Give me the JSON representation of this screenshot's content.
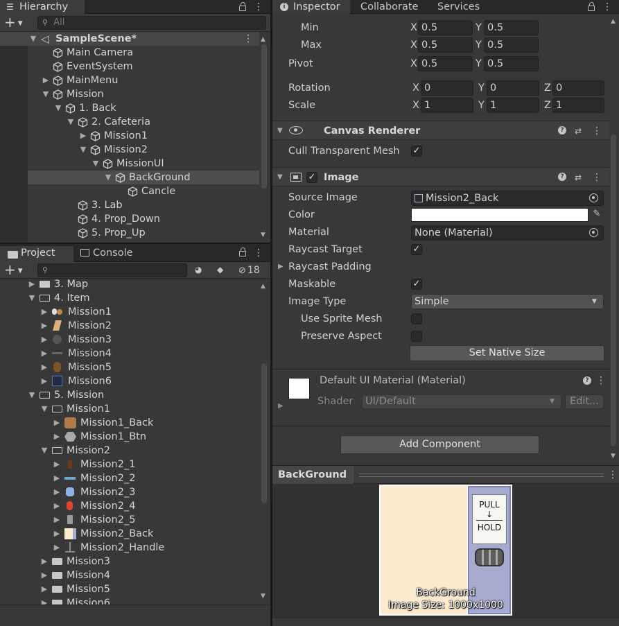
{
  "hierarchy": {
    "tab": "Hierarchy",
    "search_placeholder": "All",
    "scene": "SampleScene*",
    "items": [
      {
        "label": "Main Camera"
      },
      {
        "label": "EventSystem"
      },
      {
        "label": "MainMenu"
      },
      {
        "label": "Mission"
      },
      {
        "label": "1. Back"
      },
      {
        "label": "2. Cafeteria"
      },
      {
        "label": "Mission1"
      },
      {
        "label": "Mission2"
      },
      {
        "label": "MissionUI"
      },
      {
        "label": "BackGround"
      },
      {
        "label": "Cancle"
      },
      {
        "label": "3. Lab"
      },
      {
        "label": "4. Prop_Down"
      },
      {
        "label": "5. Prop_Up"
      }
    ]
  },
  "project": {
    "tabs": [
      "Project",
      "Console"
    ],
    "hidden_count": "18",
    "items": [
      {
        "label": "3. Map"
      },
      {
        "label": "4. Item"
      },
      {
        "label": "Mission1"
      },
      {
        "label": "Mission2"
      },
      {
        "label": "Mission3"
      },
      {
        "label": "Mission4"
      },
      {
        "label": "Mission5"
      },
      {
        "label": "Mission6"
      },
      {
        "label": "5. Mission"
      },
      {
        "label": "Mission1"
      },
      {
        "label": "Mission1_Back"
      },
      {
        "label": "Mission1_Btn"
      },
      {
        "label": "Mission2"
      },
      {
        "label": "Mission2_1"
      },
      {
        "label": "Mission2_2"
      },
      {
        "label": "Mission2_3"
      },
      {
        "label": "Mission2_4"
      },
      {
        "label": "Mission2_5"
      },
      {
        "label": "Mission2_Back"
      },
      {
        "label": "Mission2_Handle"
      },
      {
        "label": "Mission3"
      },
      {
        "label": "Mission4"
      },
      {
        "label": "Mission5"
      },
      {
        "label": "Mission6"
      }
    ]
  },
  "inspector": {
    "tabs": [
      "Inspector",
      "Collaborate",
      "Services"
    ],
    "anchors": {
      "min_label": "Min",
      "min_x": "0.5",
      "min_y": "0.5",
      "max_label": "Max",
      "max_x": "0.5",
      "max_y": "0.5"
    },
    "pivot": {
      "label": "Pivot",
      "x": "0.5",
      "y": "0.5"
    },
    "rotation": {
      "label": "Rotation",
      "x": "0",
      "y": "0",
      "z": "0"
    },
    "scale": {
      "label": "Scale",
      "x": "1",
      "y": "1",
      "z": "1"
    },
    "axes": {
      "x": "X",
      "y": "Y",
      "z": "Z"
    },
    "canvas_renderer": {
      "title": "Canvas Renderer",
      "cull_label": "Cull Transparent Mesh",
      "cull_checked": true
    },
    "image": {
      "title": "Image",
      "source_label": "Source Image",
      "source_value": "Mission2_Back",
      "color_label": "Color",
      "color_value": "#ffffff",
      "material_label": "Material",
      "material_value": "None (Material)",
      "raycast_target_label": "Raycast Target",
      "raycast_padding_label": "Raycast Padding",
      "maskable_label": "Maskable",
      "image_type_label": "Image Type",
      "image_type_value": "Simple",
      "use_sprite_mesh_label": "Use Sprite Mesh",
      "preserve_aspect_label": "Preserve Aspect",
      "set_native_size": "Set Native Size"
    },
    "material": {
      "title": "Default UI Material (Material)",
      "shader_label": "Shader",
      "shader_value": "UI/Default",
      "edit": "Edit..."
    },
    "add_component": "Add Component"
  },
  "preview": {
    "title": "BackGround",
    "caption_name": "BackGround",
    "caption_size": "Image Size: 1000x1000",
    "sign_top": "PULL",
    "sign_bottom": "HOLD"
  },
  "colors": {
    "selection": "#4d4d4d",
    "panel": "#383838",
    "accent_blue": "#3a72b0",
    "sprite_bg": "#fdebd0",
    "sprite_handle": "#a7abd0"
  }
}
